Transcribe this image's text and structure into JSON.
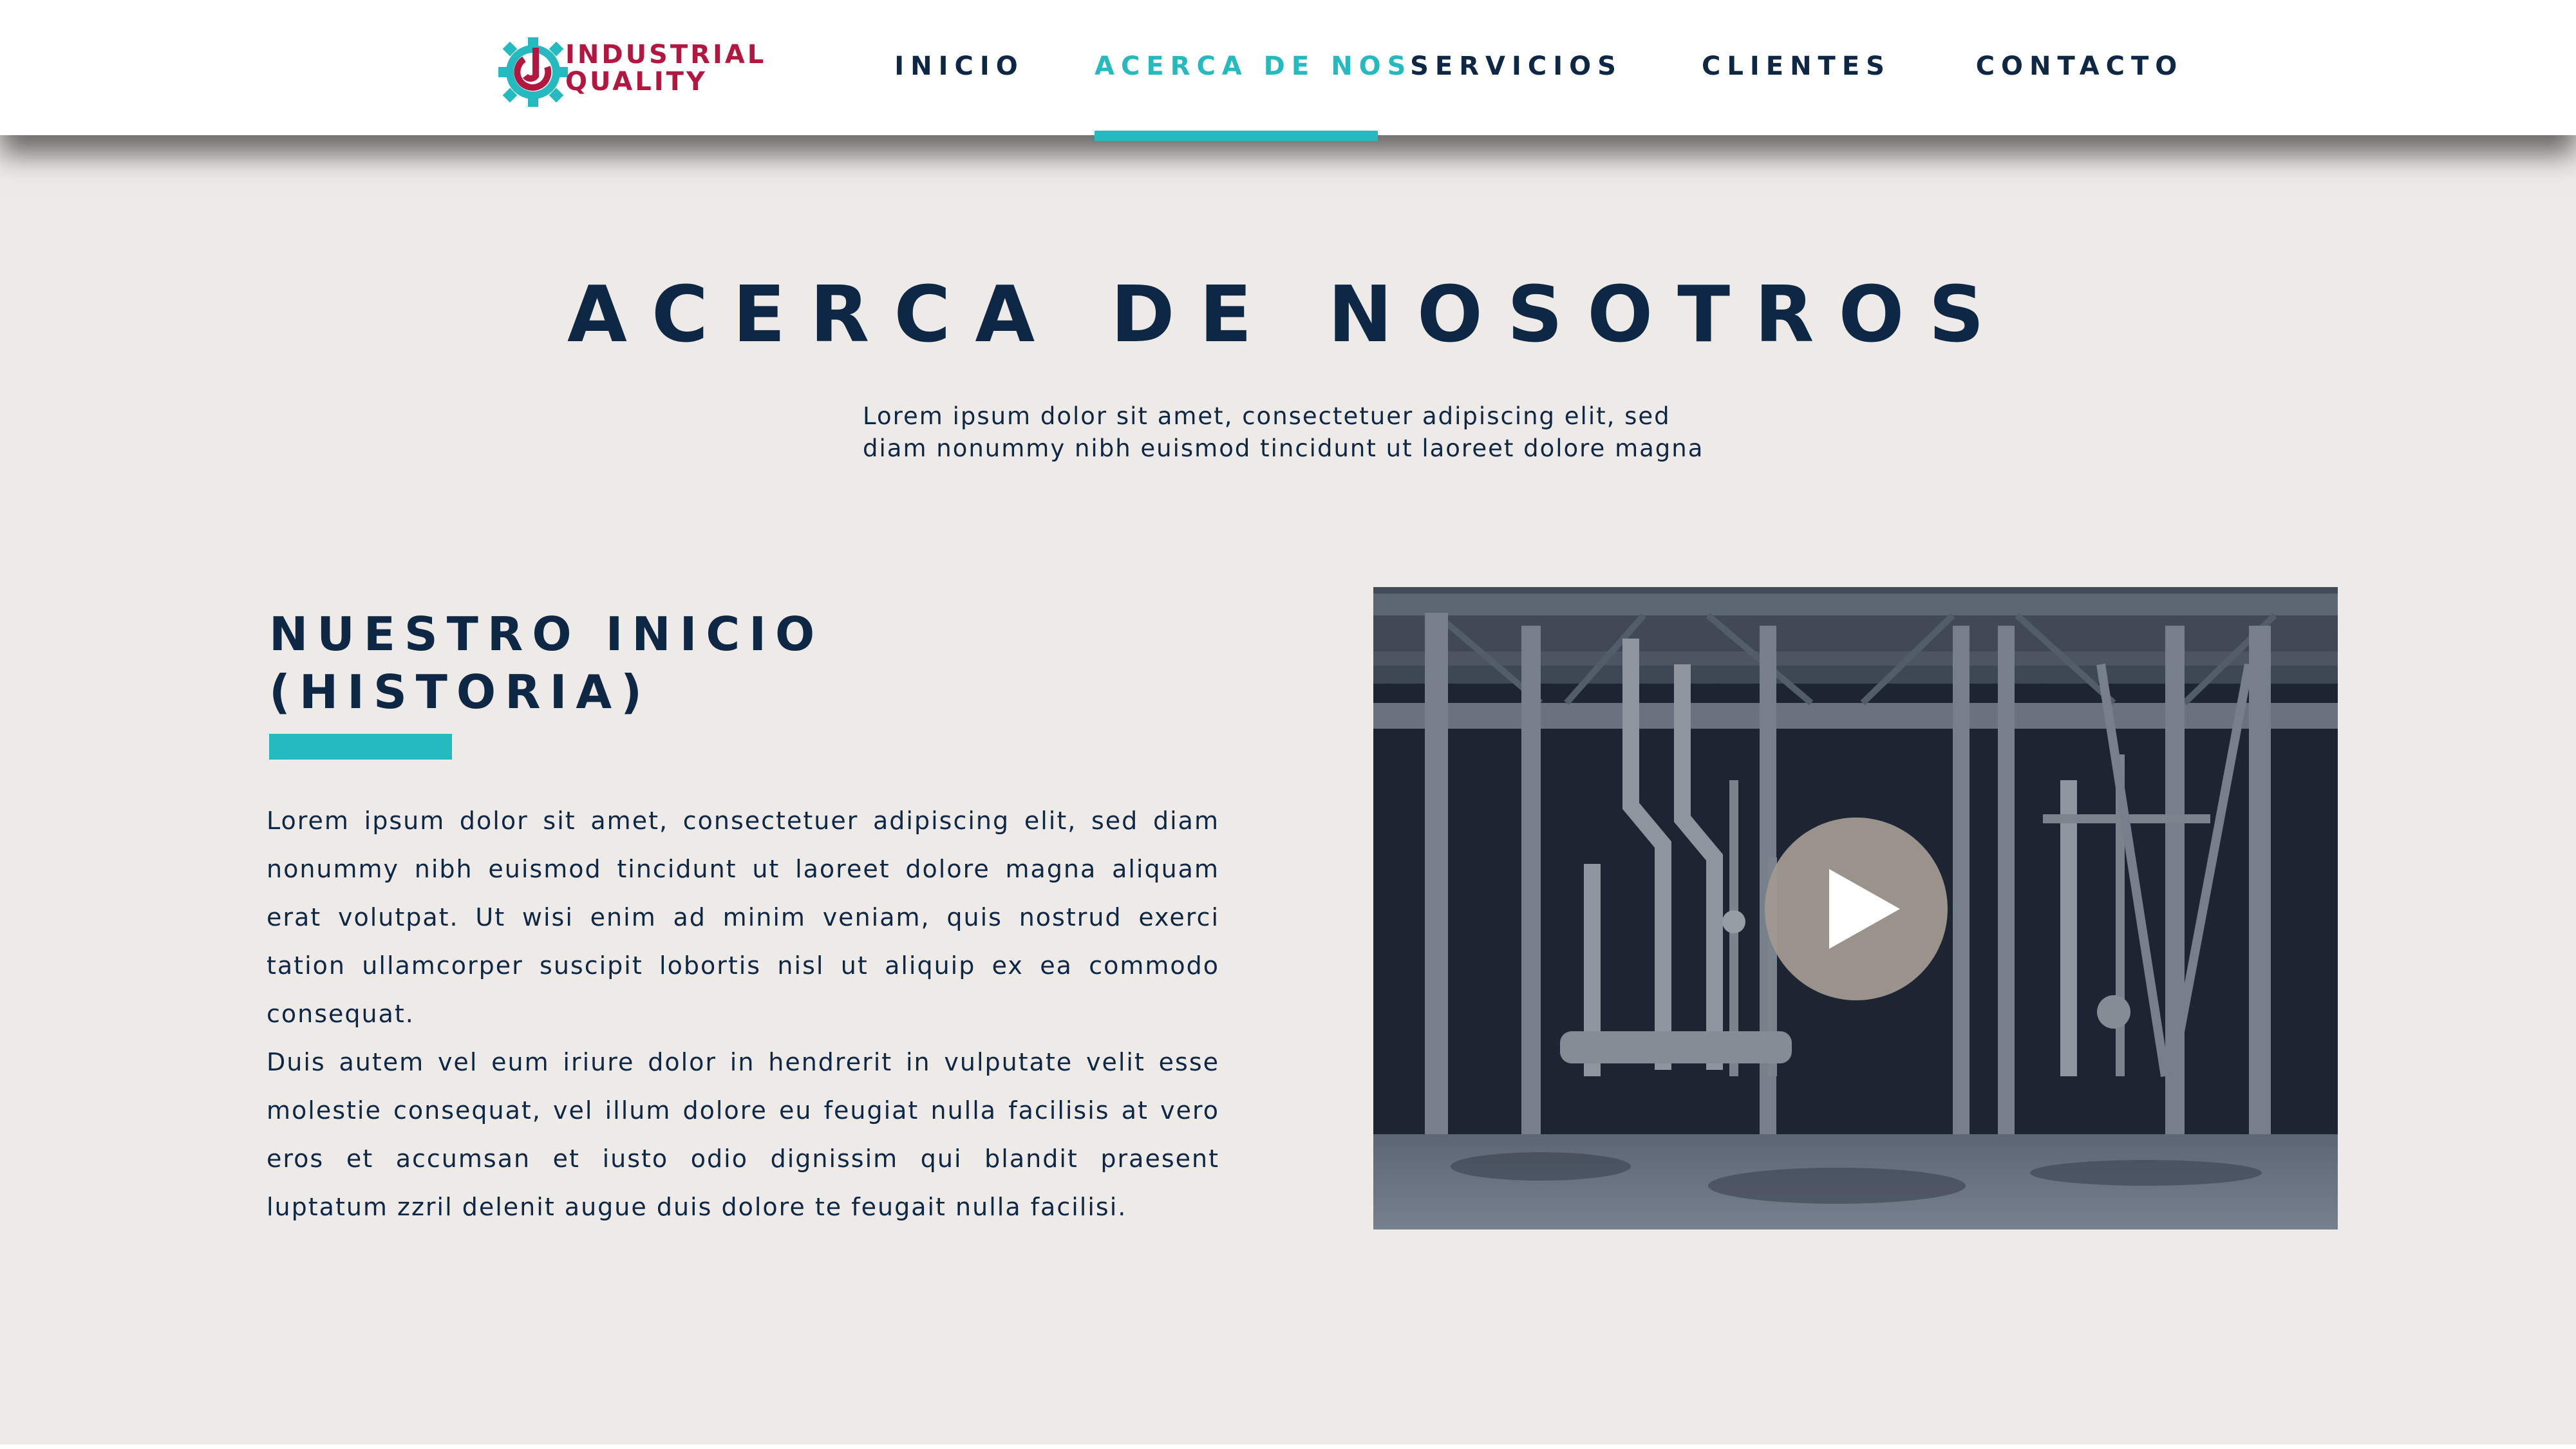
{
  "brand": {
    "line1": "INDUSTRIAL",
    "line2": "QUALITY",
    "colors": {
      "primary": "#b3173f",
      "accent": "#25b9c0",
      "navy": "#0d2745"
    }
  },
  "nav": {
    "items": [
      {
        "label": "INICIO",
        "active": false
      },
      {
        "label": "ACERCA DE NOS",
        "active": true
      },
      {
        "label": "SERVICIOS",
        "active": false
      },
      {
        "label": "CLIENTES",
        "active": false
      },
      {
        "label": "CONTACTO",
        "active": false
      }
    ]
  },
  "hero": {
    "title": "ACERCA DE NOSOTROS",
    "subtitle_line1": "Lorem ipsum dolor sit amet, consectetuer adipiscing elit, sed",
    "subtitle_line2": "diam nonummy nibh euismod tincidunt ut laoreet dolore magna"
  },
  "history": {
    "heading_line1": "NUESTRO INICIO",
    "heading_line2": "(HISTORIA)",
    "paragraph1": "Lorem ipsum dolor sit amet, consectetuer adipiscing elit, sed diam nonummy nibh euismod tincidunt ut laoreet dolore magna aliquam erat volutpat. Ut wisi enim ad minim veniam, quis nostrud exerci tation ullam­corper suscipit lobortis nisl ut aliquip ex ea commodo consequat.",
    "paragraph2": "Duis autem vel eum iriure dolor in hendrerit in vulputate velit esse moles­tie consequat, vel illum dolore eu feugiat nulla facilisis at vero eros et ac­cumsan et iusto odio dignissim qui blandit praesent luptatum zzril delenit augue duis dolore te feugait nulla facilisi."
  },
  "video": {
    "icon": "play-icon"
  }
}
